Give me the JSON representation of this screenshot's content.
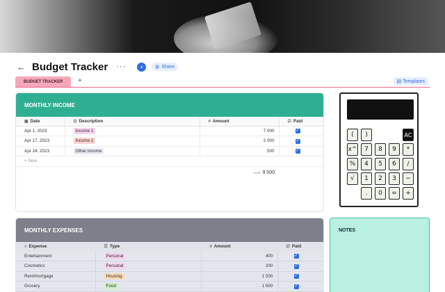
{
  "page": {
    "title": "Budget Tracker",
    "more_label": "···",
    "share_label": "Share",
    "avatar_initial": "+"
  },
  "tabs": {
    "active_label": "BUDGET TRACKER",
    "add_label": "+",
    "templates_label": "Templates"
  },
  "income": {
    "title": "MONTHLY INCOME",
    "columns": [
      "Date",
      "Description",
      "Amount",
      "Paid"
    ],
    "rows": [
      {
        "date": "Apr 1, 2023",
        "description": "Income 1",
        "amount": "7 000",
        "paid": true,
        "color": "#f6d3ef"
      },
      {
        "date": "Apr 17, 2023",
        "description": "Income 2",
        "amount": "2 000",
        "paid": true,
        "color": "#fbd3cf"
      },
      {
        "date": "Apr 24, 2023",
        "description": "Other income",
        "amount": "500",
        "paid": true,
        "color": "#e6e9f2"
      }
    ],
    "new_label": "New",
    "sum_label": "SUM",
    "sum_value": "9 500"
  },
  "expenses": {
    "title": "MONTHLY EXPENSES",
    "columns": [
      "Expense",
      "Type",
      "Amount",
      "Paid"
    ],
    "rows": [
      {
        "expense": "Entertainment",
        "type": "Personal",
        "amount": "400",
        "paid": true,
        "color": "#f6d3ef"
      },
      {
        "expense": "Cosmetics",
        "type": "Personal",
        "amount": "200",
        "paid": true,
        "color": "#f6d3ef"
      },
      {
        "expense": "Rent/mortgage",
        "type": "Housing",
        "amount": "1 500",
        "paid": true,
        "color": "#fbd9b4"
      },
      {
        "expense": "Grocery",
        "type": "Food",
        "amount": "1 500",
        "paid": true,
        "color": "#cdeec5"
      }
    ]
  },
  "calculator": {
    "keys": [
      "(",
      ")",
      "AC",
      "x^",
      "7",
      "8",
      "9",
      "*",
      "%",
      "4",
      "5",
      "6",
      "/",
      "√",
      "1",
      "2",
      "3",
      "−",
      ".",
      "0",
      "=",
      "+"
    ]
  },
  "notes": {
    "title": "NOTES"
  },
  "colors": {
    "income_header": "#2faf92",
    "expenses_header": "#7d7f8a",
    "accent": "#2f6ee0",
    "tab_pink": "#f6a8b8"
  }
}
